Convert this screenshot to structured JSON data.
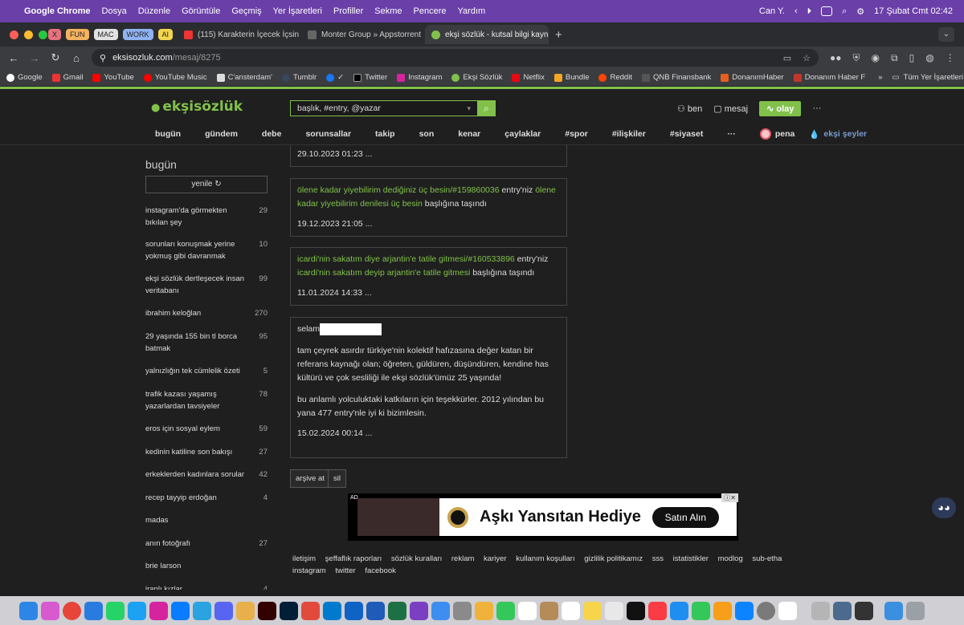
{
  "menubar": {
    "app": "Google Chrome",
    "items": [
      "Dosya",
      "Düzenle",
      "Görüntüle",
      "Geçmiş",
      "Yer İşaretleri",
      "Profiller",
      "Sekme",
      "Pencere",
      "Yardım"
    ],
    "user": "Can Y.",
    "datetime": "17 Şubat Cmt  02:42"
  },
  "tabs": {
    "pills": [
      "X",
      "FUN",
      "MAC",
      "WORK",
      "AI"
    ],
    "items": [
      {
        "label": "(115) Karakterin İçecek İçsin"
      },
      {
        "label": "Monter Group » Appstorrent"
      },
      {
        "label": "ekşi sözlük - kutsal bilgi kayn..."
      }
    ]
  },
  "address": {
    "host": "eksisozluk.com",
    "path": "/mesaj/8275"
  },
  "bookmarks": [
    "Google",
    "Gmail",
    "YouTube",
    "YouTube Music",
    "C'ansterdam'",
    "Tumblr",
    "✓",
    "Twitter",
    "Instagram",
    "Ekşi Sözlük",
    "Netflix",
    "Bundle",
    "Reddit",
    "QNB Finansbank",
    "DonanımHaber",
    "Donanım Haber F",
    "Tüm Yer İşaretleri"
  ],
  "site": {
    "logo": "ekşisözlük",
    "search_placeholder": "başlık, #entry, @yazar",
    "ben": "ben",
    "mesaj": "mesaj",
    "olay": "olay",
    "more": "···",
    "nav": [
      "bugün",
      "gündem",
      "debe",
      "sorunsallar",
      "takip",
      "son",
      "kenar",
      "çaylaklar",
      "#spor",
      "#ilişkiler",
      "#siyaset",
      "···"
    ],
    "pena": "pena",
    "seyler": "ekşi şeyler"
  },
  "sidebar": {
    "title": "bugün",
    "refresh": "yenile",
    "items": [
      {
        "title": "instagram'da görmekten bıkılan şey",
        "count": "29"
      },
      {
        "title": "sorunları konuşmak yerine yokmuş gibi davranmak",
        "count": "10"
      },
      {
        "title": "ekşi sözlük dertleşecek insan veritabanı",
        "count": "99"
      },
      {
        "title": "ibrahim keloğlan",
        "count": "270"
      },
      {
        "title": "29 yaşında 155 bin tl borca batmak",
        "count": "95"
      },
      {
        "title": "yalnızlığın tek cümlelik özeti",
        "count": "5"
      },
      {
        "title": "trafik kazası yaşamış yazarlardan tavsiyeler",
        "count": "78"
      },
      {
        "title": "eros için sosyal eylem",
        "count": "59"
      },
      {
        "title": "kedinin katiline son bakışı",
        "count": "27"
      },
      {
        "title": "erkeklerden kadınlara sorular",
        "count": "42"
      },
      {
        "title": "recep tayyip erdoğan",
        "count": "4"
      },
      {
        "title": "madas",
        "count": ""
      },
      {
        "title": "anın fotoğrafı",
        "count": "27"
      },
      {
        "title": "brie larson",
        "count": ""
      },
      {
        "title": "iranlı kızlar",
        "count": "4"
      }
    ]
  },
  "messages": {
    "m0_date": "29.10.2023 01:23  ...",
    "m1": {
      "link1": "ölene kadar yiyebilirim dediğiniz üç besin/#159860036",
      "mid": " entry'niz ",
      "link2": "ölene kadar yiyebilirim denilesi üç besin",
      "tail": " başlığına taşındı",
      "date": "19.12.2023 21:05  ..."
    },
    "m2": {
      "link1": "icardi'nin sakatım diye arjantin'e tatile gitmesi/#160533896",
      "mid": " entry'niz ",
      "link2": "icardi'nin sakatım deyip arjantin'e tatile gitmesi",
      "tail": " başlığına taşındı",
      "date": "11.01.2024 14:33  ..."
    },
    "m3": {
      "greeting": "selam",
      "p1": "tam çeyrek asırdır türkiye'nin kolektif hafızasına değer katan bir referans kaynağı olan; öğreten, güldüren, düşündüren, kendine has kültürü ve çok sesliliği ile ekşi sözlük'ümüz 25 yaşında!",
      "p2": "bu anlamlı yolculuktaki katkıların için teşekkürler. 2012 yılından bu yana 477 entry'nle iyi ki bizimlesin.",
      "date": "15.02.2024 00:14  ..."
    },
    "archive_btn": "arşive at",
    "delete_btn": "sil"
  },
  "ad": {
    "label": "AD",
    "headline": "Aşkı Yansıtan Hediye",
    "cta": "Satın Alın"
  },
  "footer": [
    "iletişim",
    "şeffaflık raporları",
    "sözlük kuralları",
    "reklam",
    "kariyer",
    "kullanım koşulları",
    "gizlilik politikamız",
    "sss",
    "istatistikler",
    "modlog",
    "sub-etha",
    "instagram",
    "twitter",
    "facebook"
  ]
}
